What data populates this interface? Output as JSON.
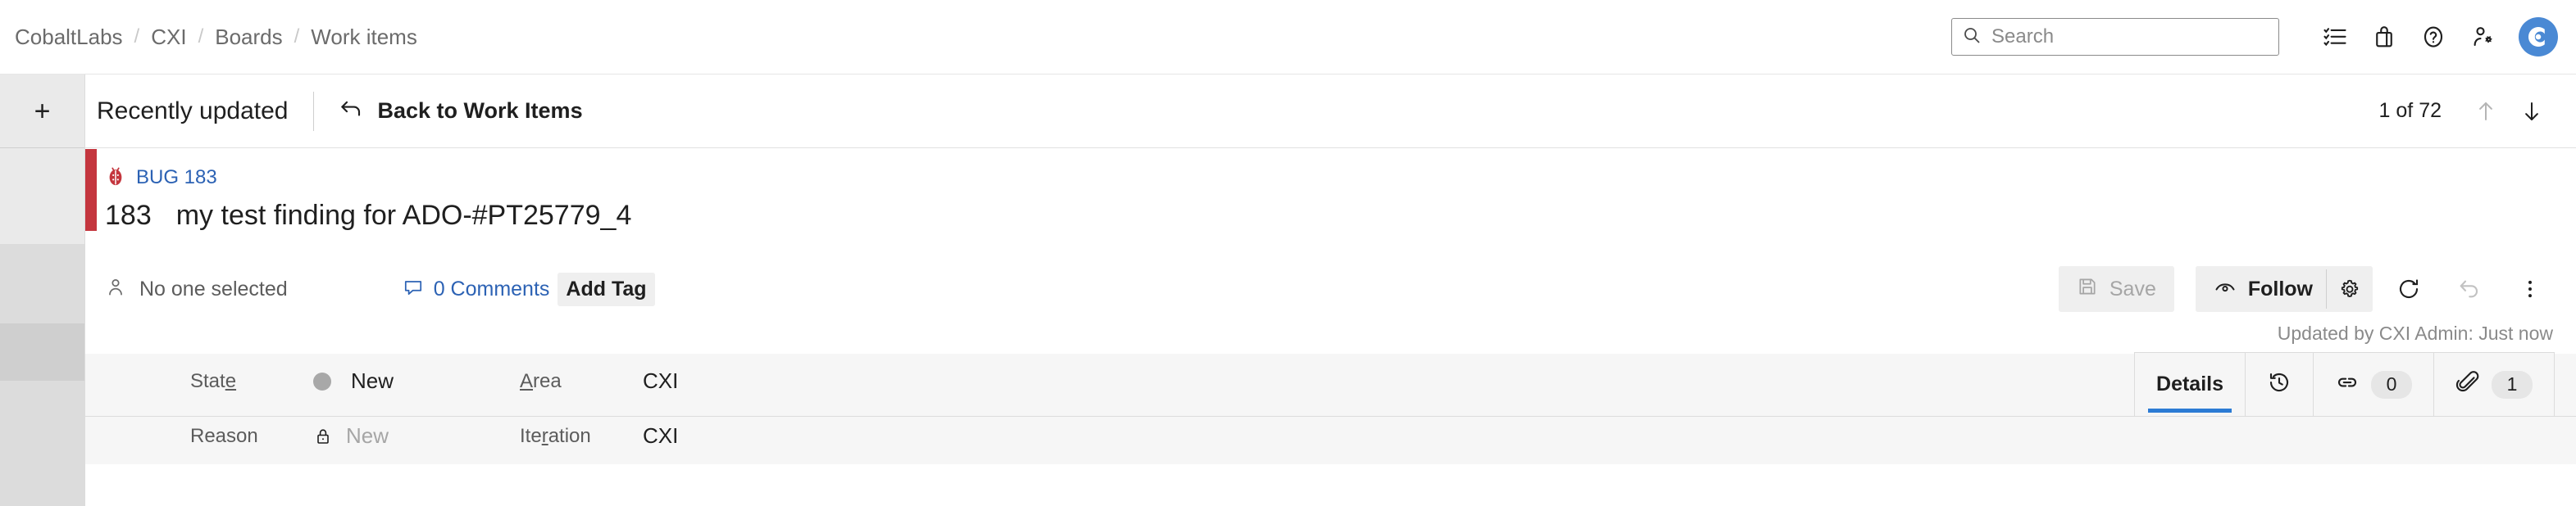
{
  "breadcrumb": {
    "items": [
      "CobaltLabs",
      "CXI",
      "Boards",
      "Work items"
    ],
    "separator": "/"
  },
  "header": {
    "search": {
      "value": "",
      "placeholder": "Search"
    },
    "icons": [
      {
        "name": "tasks-icon",
        "label": "Tasks"
      },
      {
        "name": "marketplace-icon",
        "label": "Marketplace"
      },
      {
        "name": "help-icon",
        "label": "Help"
      },
      {
        "name": "user-settings-icon",
        "label": "User settings"
      }
    ],
    "avatar": {
      "initial": "C",
      "color": "#4a89d4"
    }
  },
  "sidebar": {
    "add_label": "+"
  },
  "toolbar": {
    "view_title": "Recently updated",
    "back_label": "Back to Work Items",
    "pager": {
      "count_label": "1 of 72",
      "prev_enabled": false,
      "next_enabled": true
    }
  },
  "work_item": {
    "type_label": "BUG 183",
    "type_color": "#c4363e",
    "id": "183",
    "title": "my test finding for ADO-#PT25779_4",
    "assignee": "No one selected",
    "comments_label": "0 Comments",
    "add_tag_label": "Add Tag",
    "updated_text": "Updated by CXI Admin: Just now",
    "actions": {
      "save_label": "Save",
      "save_enabled": false,
      "follow_label": "Follow",
      "follow_settings": "gear-icon",
      "refresh": "refresh-icon",
      "revert": "revert-icon",
      "more": "more-options-icon"
    },
    "fields": [
      {
        "label": "Stat",
        "accel": "e",
        "label_tail": "",
        "value": "New",
        "value_muted": false,
        "indicator": "dot",
        "label2": "",
        "accel2": "A",
        "label2_tail": "rea",
        "value2": "CXI"
      },
      {
        "label": "Reason",
        "accel": "",
        "label_tail": "",
        "value": "New",
        "value_muted": true,
        "indicator": "lock",
        "label2": "Ite",
        "accel2": "r",
        "label2_tail": "ation",
        "value2": "CXI"
      }
    ],
    "tabs": [
      {
        "label": "Details",
        "icon": "",
        "badge": "",
        "active": true
      },
      {
        "label": "",
        "icon": "history-icon",
        "badge": "",
        "active": false
      },
      {
        "label": "",
        "icon": "links-icon",
        "badge": "0",
        "active": false
      },
      {
        "label": "",
        "icon": "attachments-icon",
        "badge": "1",
        "active": false
      }
    ]
  }
}
